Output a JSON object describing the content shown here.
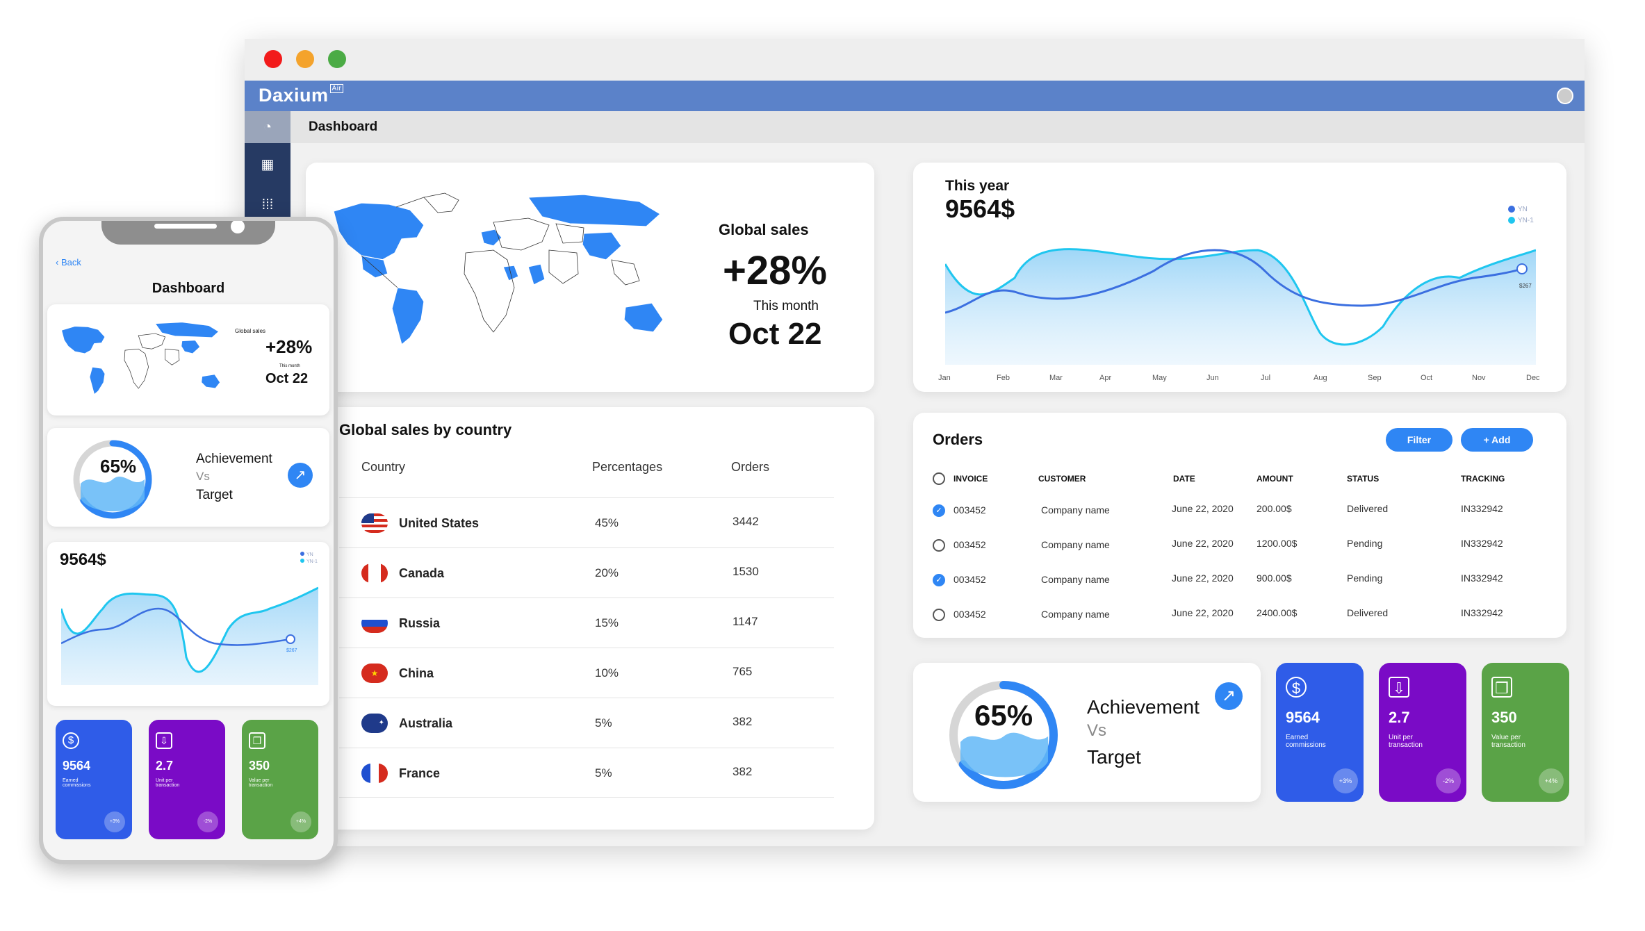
{
  "window": {
    "logo": "Daxium",
    "logo_badge": "Air",
    "page_title": "Dashboard"
  },
  "global_sales": {
    "label": "Global sales",
    "value": "+28%",
    "period": "This month",
    "date": "Oct 22"
  },
  "country_table": {
    "title": "Global sales by country",
    "headers": {
      "country": "Country",
      "percentages": "Percentages",
      "orders": "Orders"
    },
    "rows": [
      {
        "country": "United States",
        "pct": "45%",
        "orders": "3442"
      },
      {
        "country": "Canada",
        "pct": "20%",
        "orders": "1530"
      },
      {
        "country": "Russia",
        "pct": "15%",
        "orders": "1147"
      },
      {
        "country": "China",
        "pct": "10%",
        "orders": "765"
      },
      {
        "country": "Australia",
        "pct": "5%",
        "orders": "382"
      },
      {
        "country": "France",
        "pct": "5%",
        "orders": "382"
      }
    ]
  },
  "this_year": {
    "label": "This year",
    "value": "9564$",
    "legend": [
      "YN",
      "YN-1"
    ],
    "point_label": "$267",
    "months": [
      "Jan",
      "Feb",
      "Mar",
      "Apr",
      "May",
      "Jun",
      "Jul",
      "Aug",
      "Sep",
      "Oct",
      "Nov",
      "Dec"
    ]
  },
  "orders": {
    "title": "Orders",
    "filter_label": "Filter",
    "add_label": "+ Add",
    "headers": {
      "invoice": "INVOICE",
      "customer": "CUSTOMER",
      "date": "DATE",
      "amount": "AMOUNT",
      "status": "STATUS",
      "tracking": "TRACKING"
    },
    "rows": [
      {
        "checked": true,
        "invoice": "003452",
        "customer": "Company name",
        "date": "June 22, 2020",
        "amount": "200.00$",
        "status": "Delivered",
        "tracking": "IN332942"
      },
      {
        "checked": false,
        "invoice": "003452",
        "customer": "Company name",
        "date": "June 22, 2020",
        "amount": "1200.00$",
        "status": "Pending",
        "tracking": "IN332942"
      },
      {
        "checked": true,
        "invoice": "003452",
        "customer": "Company name",
        "date": "June 22, 2020",
        "amount": "900.00$",
        "status": "Pending",
        "tracking": "IN332942"
      },
      {
        "checked": false,
        "invoice": "003452",
        "customer": "Company name",
        "date": "June 22, 2020",
        "amount": "2400.00$",
        "status": "Delivered",
        "tracking": "IN332942"
      }
    ]
  },
  "achievement": {
    "percent": "65%",
    "progress": 0.65,
    "line1": "Achievement",
    "vs": "Vs",
    "line2": "Target"
  },
  "kpis": [
    {
      "value": "9564",
      "label": "Earned commissions",
      "badge": "+3%",
      "color": "#2f5ce8",
      "icon": "dollar-icon"
    },
    {
      "value": "2.7",
      "label": "Unit per transaction",
      "badge": "-2%",
      "color": "#7a0bc6",
      "icon": "inbox-icon"
    },
    {
      "value": "350",
      "label": "Value per transaction",
      "badge": "+4%",
      "color": "#5aa347",
      "icon": "boxes-icon"
    }
  ],
  "phone": {
    "back_label": "Back",
    "title": "Dashboard",
    "global_label": "Global sales",
    "global_value": "+28%",
    "global_period": "This month",
    "global_date": "Oct 22",
    "ach_percent": "65%",
    "ach_line1": "Achievement",
    "ach_vs": "Vs",
    "ach_line2": "Target",
    "chart_value": "9564$",
    "legend": [
      "YN",
      "YN-1"
    ],
    "point_label": "$267"
  },
  "colors": {
    "appbar": "#5b82c9",
    "sidebar": "#263a63",
    "accent": "#2f86f4",
    "map_highlight": "#2f86f4",
    "line_yn": "#3b6fe0",
    "line_yn1": "#1fc6ef"
  }
}
